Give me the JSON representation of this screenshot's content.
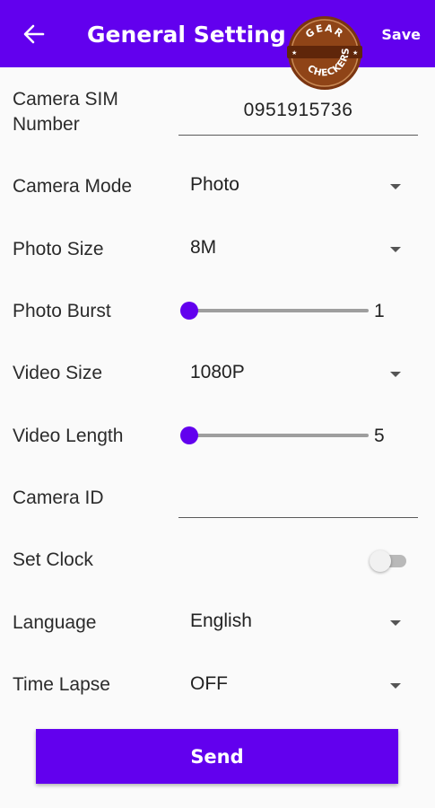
{
  "appbar": {
    "title": "General Setting",
    "save_label": "Save",
    "back_icon": "arrow-left-icon",
    "color": "#6200ee"
  },
  "watermark": {
    "top_text": "GEAR",
    "bottom_text": "CHECKERS"
  },
  "settings": {
    "sim_number": {
      "label": "Camera SIM Number",
      "value": "0951915736"
    },
    "camera_mode": {
      "label": "Camera Mode",
      "value": "Photo"
    },
    "photo_size": {
      "label": "Photo Size",
      "value": "8M"
    },
    "photo_burst": {
      "label": "Photo Burst",
      "value": "1"
    },
    "video_size": {
      "label": "Video Size",
      "value": "1080P"
    },
    "video_length": {
      "label": "Video Length",
      "value": "5"
    },
    "camera_id": {
      "label": "Camera ID",
      "value": ""
    },
    "set_clock": {
      "label": "Set Clock",
      "enabled": false
    },
    "language": {
      "label": "Language",
      "value": "English"
    },
    "time_lapse": {
      "label": "Time Lapse",
      "value": "OFF"
    }
  },
  "send_label": "Send"
}
